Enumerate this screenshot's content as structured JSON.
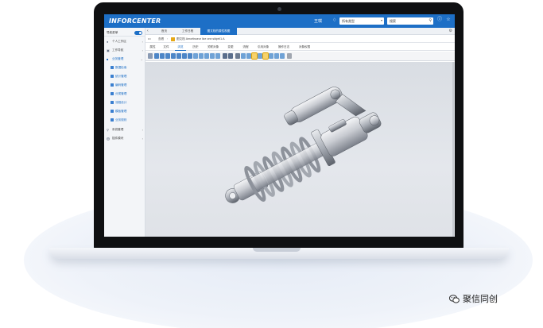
{
  "app": {
    "logo_text": "INFORCENTER",
    "username": "王琪",
    "search_type": "所有类型",
    "search_placeholder": "搜索"
  },
  "sidebar": {
    "toggle_label": "导航菜单",
    "items": [
      {
        "label": "个人工作区",
        "icon": "user-icon"
      },
      {
        "label": "工作导航",
        "icon": "nav-icon"
      },
      {
        "label": "业务管理",
        "icon": "briefcase-icon"
      }
    ],
    "sub_items": [
      {
        "label": "数据检索"
      },
      {
        "label": "统计管理"
      },
      {
        "label": "编码管理"
      },
      {
        "label": "分类管理"
      },
      {
        "label": "流程设计"
      },
      {
        "label": "模板管理"
      },
      {
        "label": "业务规则"
      }
    ],
    "bottom_items": [
      {
        "label": "系统管理",
        "icon": "search-icon"
      },
      {
        "label": "插件模块",
        "icon": "plugin-icon"
      }
    ]
  },
  "tabs": [
    {
      "label": "首页"
    },
    {
      "label": "工作日程"
    },
    {
      "label": "图文档的属性视图"
    }
  ],
  "breadcrumb": {
    "dots": "•••",
    "folder": "查看",
    "separator": "›",
    "file": "图文档 Amortisseur lice one.sldprt/1.A"
  },
  "subtabs": [
    "属性",
    "文件",
    "浏览",
    "历史",
    "关联对象",
    "变更",
    "流程",
    "引用对象",
    "操作日志",
    "对象权限"
  ],
  "colors": {
    "accent": "#1d6fc6",
    "toolbar_highlight": "#f7d26a"
  },
  "watermark": {
    "text": "聚信同创"
  }
}
